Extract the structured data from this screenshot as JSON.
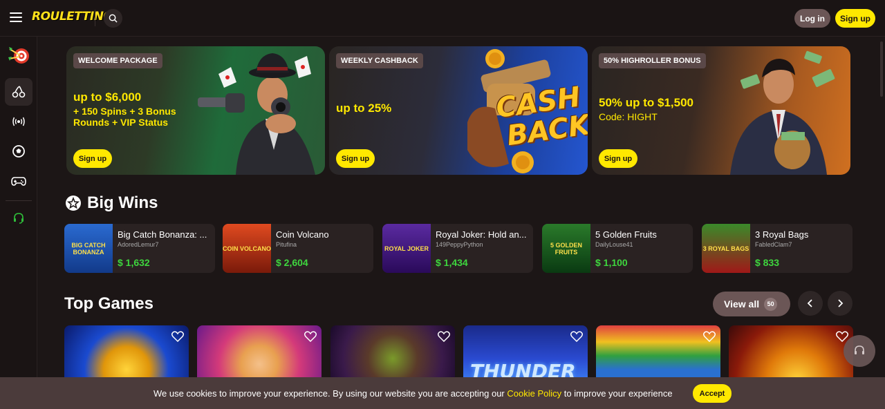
{
  "header": {
    "logo": "ROULETTINO",
    "login_label": "Log in",
    "signup_label": "Sign up"
  },
  "sidebar": {
    "items": [
      {
        "icon": "darts-icon"
      },
      {
        "icon": "cherries-icon"
      },
      {
        "icon": "live-broadcast-icon"
      },
      {
        "icon": "soccer-ball-icon"
      },
      {
        "icon": "gamepad-icon"
      },
      {
        "icon": "support-headset-icon"
      }
    ]
  },
  "promos": [
    {
      "tag": "WELCOME PACKAGE",
      "title": "up to $6,000",
      "sub1": "+ 150 Spins + 3 Bonus",
      "sub2": "Rounds + VIP Status",
      "button": "Sign up"
    },
    {
      "tag": "WEEKLY CASHBACK",
      "title": "up to 25%",
      "art_text1": "CASH",
      "art_text2": "BACK",
      "button": "Sign up"
    },
    {
      "tag": "50% HIGHROLLER BONUS",
      "title": "50% up to $1,500",
      "code": "Code: HIGHT",
      "button": "Sign up"
    }
  ],
  "big_wins": {
    "title": "Big Wins",
    "items": [
      {
        "game": "Big Catch Bonanza: ...",
        "user": "AdoredLemur7",
        "amount": "$ 1,632",
        "thumb": "BIG CATCH BONANZA"
      },
      {
        "game": "Coin Volcano",
        "user": "Pitufina",
        "amount": "$ 2,604",
        "thumb": "COIN VOLCANO"
      },
      {
        "game": "Royal Joker: Hold an...",
        "user": "149PeppyPython",
        "amount": "$ 1,434",
        "thumb": "ROYAL JOKER"
      },
      {
        "game": "5 Golden Fruits",
        "user": "DailyLouse41",
        "amount": "$ 1,100",
        "thumb": "5 GOLDEN FRUITS"
      },
      {
        "game": "3 Royal Bags",
        "user": "FabledClam7",
        "amount": "$ 833",
        "thumb": "3 ROYAL BAGS"
      }
    ]
  },
  "top_games": {
    "title": "Top Games",
    "view_all": "View all",
    "count": "50",
    "thunder": "THUNDER"
  },
  "cookie": {
    "text_before": "We use cookies to improve your experience. By using our website you are accepting our ",
    "link": "Cookie Policy",
    "text_after": " to improve your experience",
    "accept": "Accept"
  },
  "colors": {
    "accent": "#ffe800",
    "background": "#1c1616",
    "win_green": "#3ed63e"
  }
}
